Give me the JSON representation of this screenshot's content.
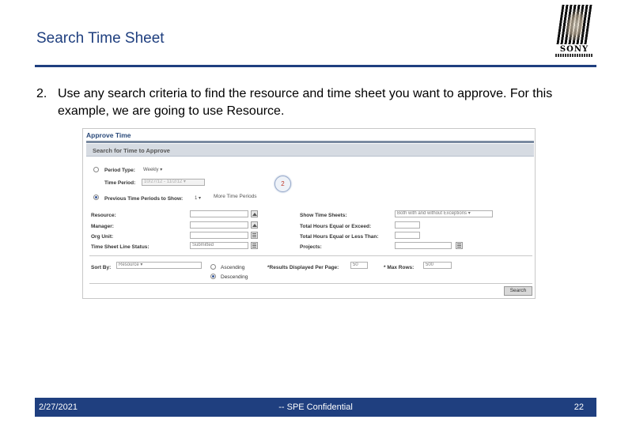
{
  "slide": {
    "title": "Search Time Sheet",
    "logo": "SONY",
    "step_number": "2.",
    "step_text": "Use any search criteria to find the resource and time sheet you want to approve. For this example, we are going to use Resource."
  },
  "screenshot": {
    "app_title": "Approve Time",
    "section_title": "Search for Time to Approve",
    "period_type_label": "Period Type:",
    "period_type_value": "Weekly",
    "time_period_label": "Time Period:",
    "time_period_value": "10/27/12 - 11/2/12",
    "previous_periods_label": "Previous Time Periods to Show:",
    "previous_periods_value": "1",
    "more_periods_link": "More Time Periods",
    "callout_number": "2",
    "resource_label": "Resource:",
    "manager_label": "Manager:",
    "org_unit_label": "Org Unit:",
    "line_status_label": "Time Sheet Line Status:",
    "line_status_value": "Submitted",
    "show_time_sheets_label": "Show Time Sheets:",
    "show_time_sheets_value": "Both with and without Exceptions",
    "total_exceed_label": "Total Hours Equal or Exceed:",
    "total_less_label": "Total Hours Equal or Less Than:",
    "projects_label": "Projects:",
    "sort_by_label": "Sort By:",
    "sort_by_value": "Resource",
    "ascending_label": "Ascending",
    "descending_label": "Descending",
    "results_per_page_label": "*Results Displayed Per Page:",
    "results_per_page_value": "50",
    "max_rows_label": "* Max Rows:",
    "max_rows_value": "500",
    "search_button": "Search"
  },
  "footer": {
    "date": "2/27/2021",
    "confidential": "-- SPE Confidential",
    "page": "22"
  },
  "colors": {
    "brand_blue": "#1f3f7f"
  }
}
